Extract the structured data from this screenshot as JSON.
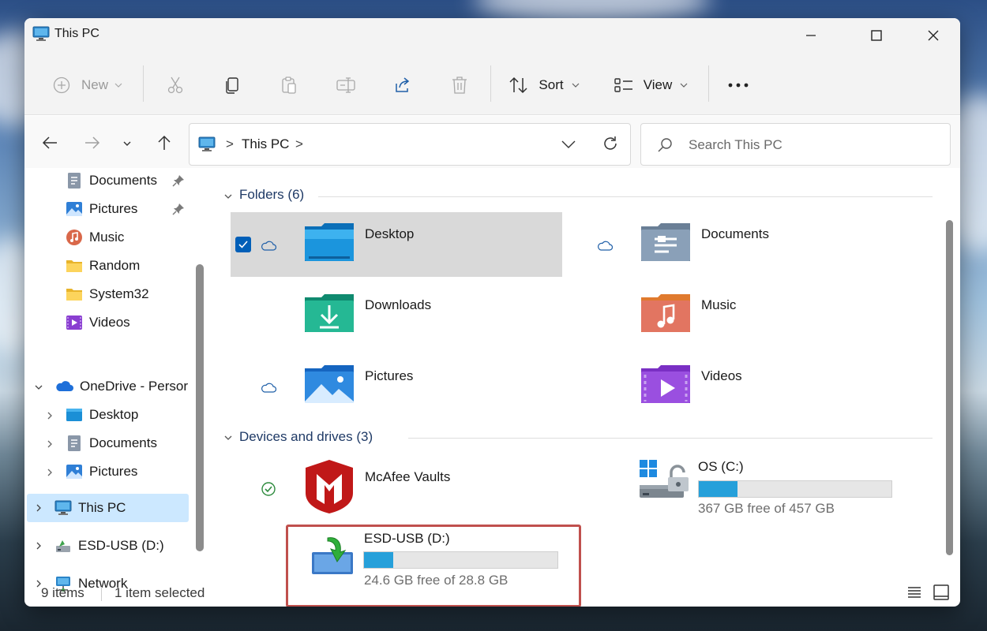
{
  "window": {
    "title": "This PC",
    "icon": "monitor-icon"
  },
  "toolbar": {
    "new_label": "New",
    "sort_label": "Sort",
    "view_label": "View",
    "icons": [
      "plus-circle-icon",
      "cut-icon",
      "copy-icon",
      "paste-icon",
      "rename-icon",
      "share-icon",
      "delete-icon",
      "sort-icon",
      "view-icon",
      "more-icon"
    ]
  },
  "address": {
    "location": "This PC",
    "separator": ">"
  },
  "search": {
    "placeholder": "Search This PC"
  },
  "sidebar": {
    "quick_access": [
      {
        "label": "Documents",
        "icon": "documents-icon",
        "pinned": true
      },
      {
        "label": "Pictures",
        "icon": "pictures-icon",
        "pinned": true
      },
      {
        "label": "Music",
        "icon": "music-icon",
        "pinned": false
      },
      {
        "label": "Random",
        "icon": "folder-icon",
        "pinned": false
      },
      {
        "label": "System32",
        "icon": "folder-icon",
        "pinned": false
      },
      {
        "label": "Videos",
        "icon": "videos-icon",
        "pinned": false
      }
    ],
    "onedrive": {
      "label": "OneDrive - Persor",
      "children": [
        "Desktop",
        "Documents",
        "Pictures"
      ]
    },
    "this_pc": "This PC",
    "usb": "ESD-USB (D:)",
    "network": "Network"
  },
  "sections": {
    "folders": "Folders (6)",
    "devices": "Devices and drives (3)"
  },
  "folders": [
    {
      "name": "Desktop",
      "selected": true,
      "cloud": true
    },
    {
      "name": "Documents",
      "selected": false,
      "cloud": true
    },
    {
      "name": "Downloads",
      "selected": false,
      "cloud": false
    },
    {
      "name": "Music",
      "selected": false,
      "cloud": false
    },
    {
      "name": "Pictures",
      "selected": false,
      "cloud": true
    },
    {
      "name": "Videos",
      "selected": false,
      "cloud": false
    }
  ],
  "drives": [
    {
      "name": "McAfee Vaults",
      "status": "synced"
    },
    {
      "name": "OS (C:)",
      "free_text": "367 GB free of 457 GB",
      "used_fraction": 0.2
    },
    {
      "name": "ESD-USB (D:)",
      "free_text": "24.6 GB free of 28.8 GB",
      "used_fraction": 0.15,
      "highlighted": true
    }
  ],
  "status": {
    "items": "9 items",
    "selected": "1 item selected"
  },
  "colors": {
    "accent": "#0067c0",
    "selection": "#cce8ff",
    "highlight_border": "#c0504d",
    "drive_bar": "#26a0da"
  }
}
